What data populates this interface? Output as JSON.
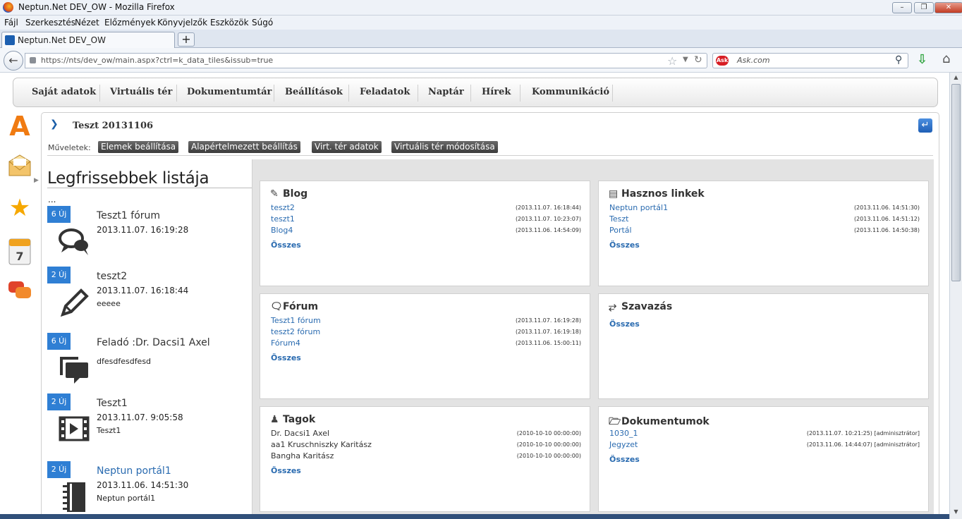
{
  "window": {
    "title": "Neptun.Net DEV_OW - Mozilla Firefox",
    "min": "–",
    "max": "❐",
    "close": "✕"
  },
  "menu": [
    "Fájl",
    "Szerkesztés",
    "Nézet",
    "Előzmények",
    "Könyvjelzők",
    "Eszközök",
    "Súgó"
  ],
  "tab": {
    "label": "Neptun.Net DEV_OW",
    "new": "+"
  },
  "nav": {
    "url": "https://nts/dev_ow/main.aspx?ctrl=k_data_tiles&issub=true",
    "search_placeholder": "Ask.com",
    "ask_logo": "Ask"
  },
  "mainnav": [
    "Saját adatok",
    "Virtuális tér",
    "Dokumentumtár",
    "Beállítások",
    "Feladatok",
    "Naptár",
    "Hírek",
    "Kommunikáció"
  ],
  "content": {
    "title": "Teszt 20131106",
    "ops_label": "Műveletek:",
    "ops": [
      "Elemek beállítása",
      "Alapértelmezett beállítás",
      "Virt. tér adatok",
      "Virtuális tér módosítása"
    ]
  },
  "leftpanel": {
    "title": "Legfrissebbek listája",
    "dots": "...",
    "items": [
      {
        "badge": "6 Új",
        "title": "Teszt1 fórum",
        "date": "2013.11.07. 16:19:28",
        "sub": "",
        "icon": "forum-icon"
      },
      {
        "badge": "2 Új",
        "title": "teszt2",
        "date": "2013.11.07. 16:18:44",
        "sub": "eeeee",
        "icon": "blog-pen-icon"
      },
      {
        "badge": "6 Új",
        "title": "Feladó :Dr. Dacsi1 Axel",
        "date": "",
        "sub": "dfesdfesdfesd",
        "icon": "message-icon"
      },
      {
        "badge": "2 Új",
        "title": "Teszt1",
        "date": "2013.11.07. 9:05:58",
        "sub": "Teszt1",
        "icon": "video-icon"
      },
      {
        "badge": "2 Új",
        "title": "Neptun portál1",
        "date": "2013.11.06. 14:51:30",
        "sub": "Neptun portál1",
        "icon": "links-notebook-icon"
      }
    ]
  },
  "tiles": {
    "all_label": "Összes",
    "blog": {
      "title": "Blog",
      "rows": [
        {
          "label": "teszt2",
          "date": "(2013.11.07. 16:18:44)"
        },
        {
          "label": "teszt1",
          "date": "(2013.11.07. 10:23:07)"
        },
        {
          "label": "Blog4",
          "date": "(2013.11.06. 14:54:09)"
        }
      ]
    },
    "links": {
      "title": "Hasznos linkek",
      "rows": [
        {
          "label": "Neptun portál1",
          "date": "(2013.11.06. 14:51:30)"
        },
        {
          "label": "Teszt",
          "date": "(2013.11.06. 14:51:12)"
        },
        {
          "label": "Portál",
          "date": "(2013.11.06. 14:50:38)"
        }
      ]
    },
    "forum": {
      "title": "Fórum",
      "rows": [
        {
          "label": "Teszt1 fórum",
          "date": "(2013.11.07. 16:19:28)"
        },
        {
          "label": "teszt2 fórum",
          "date": "(2013.11.07. 16:19:18)"
        },
        {
          "label": "Fórum4",
          "date": "(2013.11.06. 15:00:11)"
        }
      ]
    },
    "vote": {
      "title": "Szavazás",
      "rows": []
    },
    "members": {
      "title": "Tagok",
      "rows": [
        {
          "label": "Dr. Dacsi1 Axel",
          "date": "(2010-10-10 00:00:00)"
        },
        {
          "label": "aa1 Kruschniszky Karitász",
          "date": "(2010-10-10 00:00:00)"
        },
        {
          "label": "Bangha Karitász",
          "date": "(2010-10-10 00:00:00)"
        }
      ]
    },
    "docs": {
      "title": "Dokumentumok",
      "rows": [
        {
          "label": "1030_1",
          "date": "(2013.11.07. 10:21:25) [adminisztrátor]"
        },
        {
          "label": "Jegyzet",
          "date": "(2013.11.06. 14:44:07) [adminisztrátor]"
        }
      ]
    }
  },
  "colors": {
    "accent": "#2f7fd4",
    "link": "#2a6bb0",
    "button_dark": "#4a4a4a"
  }
}
